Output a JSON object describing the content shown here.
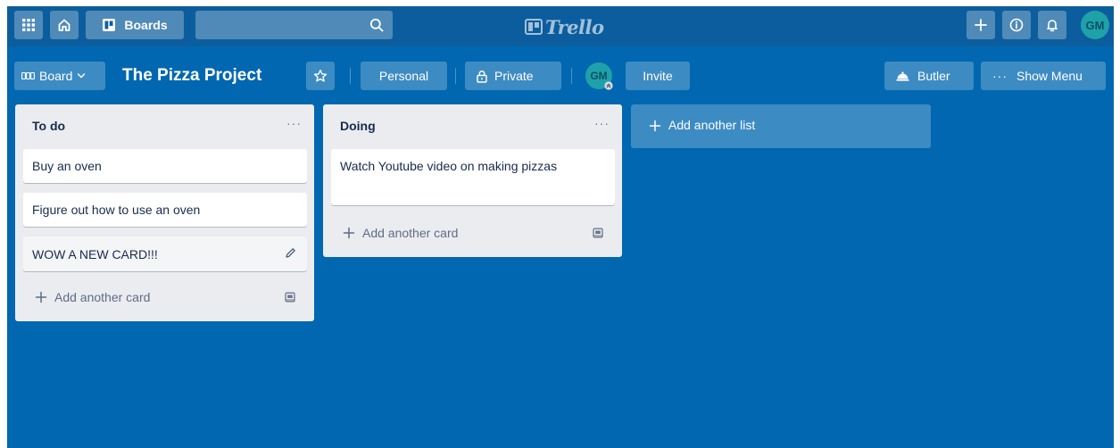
{
  "header": {
    "boards_label": "Boards",
    "search": {
      "value": "",
      "placeholder": ""
    },
    "logo_text": "Trello",
    "avatar_initials": "GM"
  },
  "board": {
    "board_button_label": "Board",
    "title": "The Pizza Project",
    "team_label": "Personal",
    "visibility_label": "Private",
    "member_initials": "GM",
    "invite_label": "Invite",
    "butler_label": "Butler",
    "show_menu_label": "Show Menu"
  },
  "lists": [
    {
      "title": "To do",
      "menu": "···",
      "cards": [
        "Buy an oven",
        "Figure out how to use an oven",
        "WOW A NEW CARD!!!"
      ],
      "add_card_label": "Add another card"
    },
    {
      "title": "Doing",
      "menu": "···",
      "cards": [
        "Watch Youtube video on making pizzas"
      ],
      "add_card_label": "Add another card"
    }
  ],
  "add_list_label": "Add another list",
  "colors": {
    "board_background": "#0067b0",
    "header_background": "#0c5d9d",
    "list_background": "#ebecf0",
    "avatar": "#1ea2a9"
  }
}
